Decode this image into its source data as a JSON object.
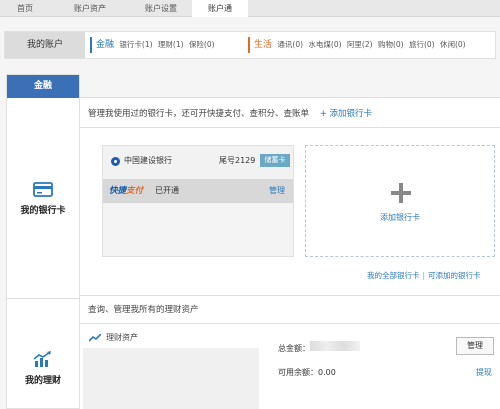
{
  "topnav": {
    "tabs": [
      "首页",
      "账户资产",
      "账户设置",
      "账户通"
    ],
    "active_index": 3
  },
  "account_bar": {
    "title": "我的账户",
    "finance": {
      "heading": "金融",
      "items": [
        "银行卡(1)",
        "理财(1)",
        "保险(0)"
      ]
    },
    "life": {
      "heading": "生活",
      "items": [
        "通讯(0)",
        "水电煤(0)",
        "阿里(2)",
        "购物(0)",
        "旅行(0)",
        "休闲(0)"
      ]
    }
  },
  "sidebar": {
    "active_tab": "金融",
    "items": [
      {
        "label": "我的银行卡",
        "icon": "bank-card-icon"
      },
      {
        "label": "我的理财",
        "icon": "chart-growth-icon"
      }
    ]
  },
  "bank_section": {
    "description": "管理我使用过的银行卡，还可开快捷支付、查积分、查账单",
    "add_link": "+ 添加银行卡",
    "card": {
      "bank_name": "中国建设银行",
      "tail": "尾号2129",
      "badge": "储蓄卡",
      "quickpay_1": "快捷",
      "quickpay_2": "支付",
      "status": "已开通",
      "manage": "管理"
    },
    "add_card_label": "添加银行卡",
    "links": [
      "我的全部银行卡",
      "可添加的银行卡"
    ],
    "link_sep": "|"
  },
  "wealth_section": {
    "description": "查询、管理我所有的理财资产",
    "asset_title": "理财资产",
    "total_label": "总金额：",
    "available": "可用余额：0.00",
    "manage_button": "管理",
    "withdraw": "提现"
  },
  "colors": {
    "accent_blue": "#2a7ab8",
    "tab_blue": "#3b6fb6",
    "life_orange": "#e06a2a"
  }
}
